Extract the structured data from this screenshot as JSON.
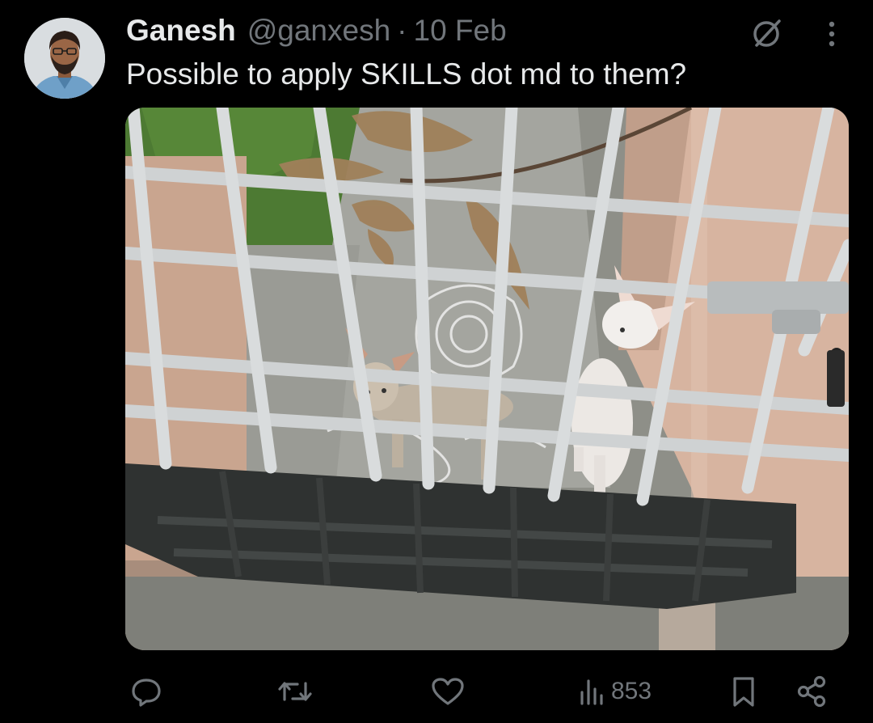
{
  "tweet": {
    "author_name": "Ganesh",
    "handle": "@ganxesh",
    "separator": "·",
    "date": "10 Feb",
    "text": "Possible to apply SKILLS dot md to them?",
    "views": "853"
  },
  "colors": {
    "background": "#000000",
    "primary_text": "#e7e9ea",
    "secondary_text": "#71767b"
  },
  "icons": {
    "grok": "grok-icon",
    "more": "more-icon",
    "reply": "reply-icon",
    "retweet": "retweet-icon",
    "like": "like-icon",
    "views": "views-icon",
    "bookmark": "bookmark-icon",
    "share": "share-icon"
  }
}
